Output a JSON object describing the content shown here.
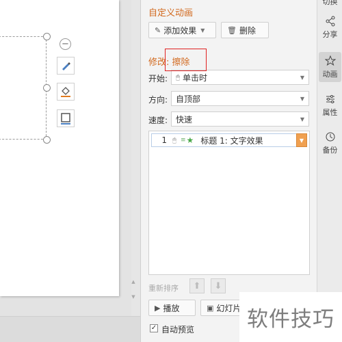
{
  "rail": {
    "top_partial": "切换",
    "share": "分享",
    "animation": "动画",
    "properties": "属性",
    "backup": "备份"
  },
  "panel": {
    "title": "自定义动画",
    "add_effect": "添加效果",
    "delete": "删除",
    "modify_prefix": "修改:",
    "modify_effect": "擦除",
    "start_label": "开始:",
    "start_value": "单击时",
    "direction_label": "方向:",
    "direction_value": "自顶部",
    "speed_label": "速度:",
    "speed_value": "快速",
    "list": [
      {
        "index": "1",
        "name": "标题 1: 文字效果"
      }
    ],
    "reorder": "重新排序",
    "play": "播放",
    "slideshow": "幻灯片",
    "autopreview": "自动预览",
    "autopreview_checked": true
  },
  "watermark": "软件技巧",
  "colors": {
    "accent_orange": "#d2691e",
    "highlight_red": "#e02020",
    "dropdown_orange": "#f0a050"
  }
}
